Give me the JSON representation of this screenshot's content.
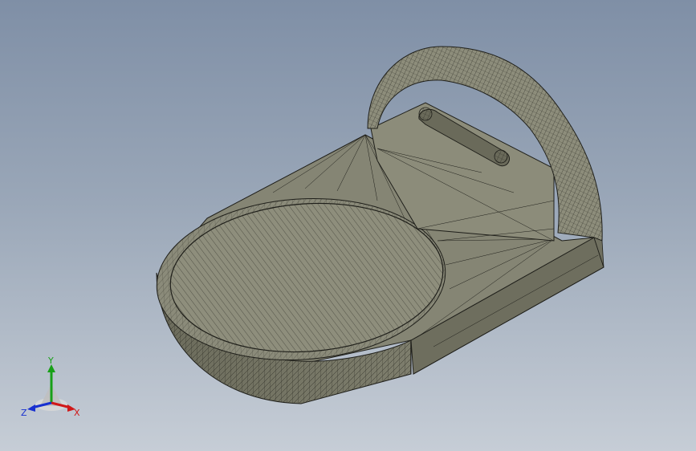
{
  "viewport": {
    "background_top": "#7f8fa6",
    "background_bottom": "#c6cdd6"
  },
  "model": {
    "name": "bracket-part",
    "render_mode": "shaded-with-mesh-edges",
    "face_color": "#8a8a78",
    "edge_color": "#1f1f1a"
  },
  "triad": {
    "x_label": "X",
    "y_label": "Y",
    "z_label": "Z",
    "x_color": "#d01818",
    "y_color": "#18a018",
    "z_color": "#1830d0"
  }
}
